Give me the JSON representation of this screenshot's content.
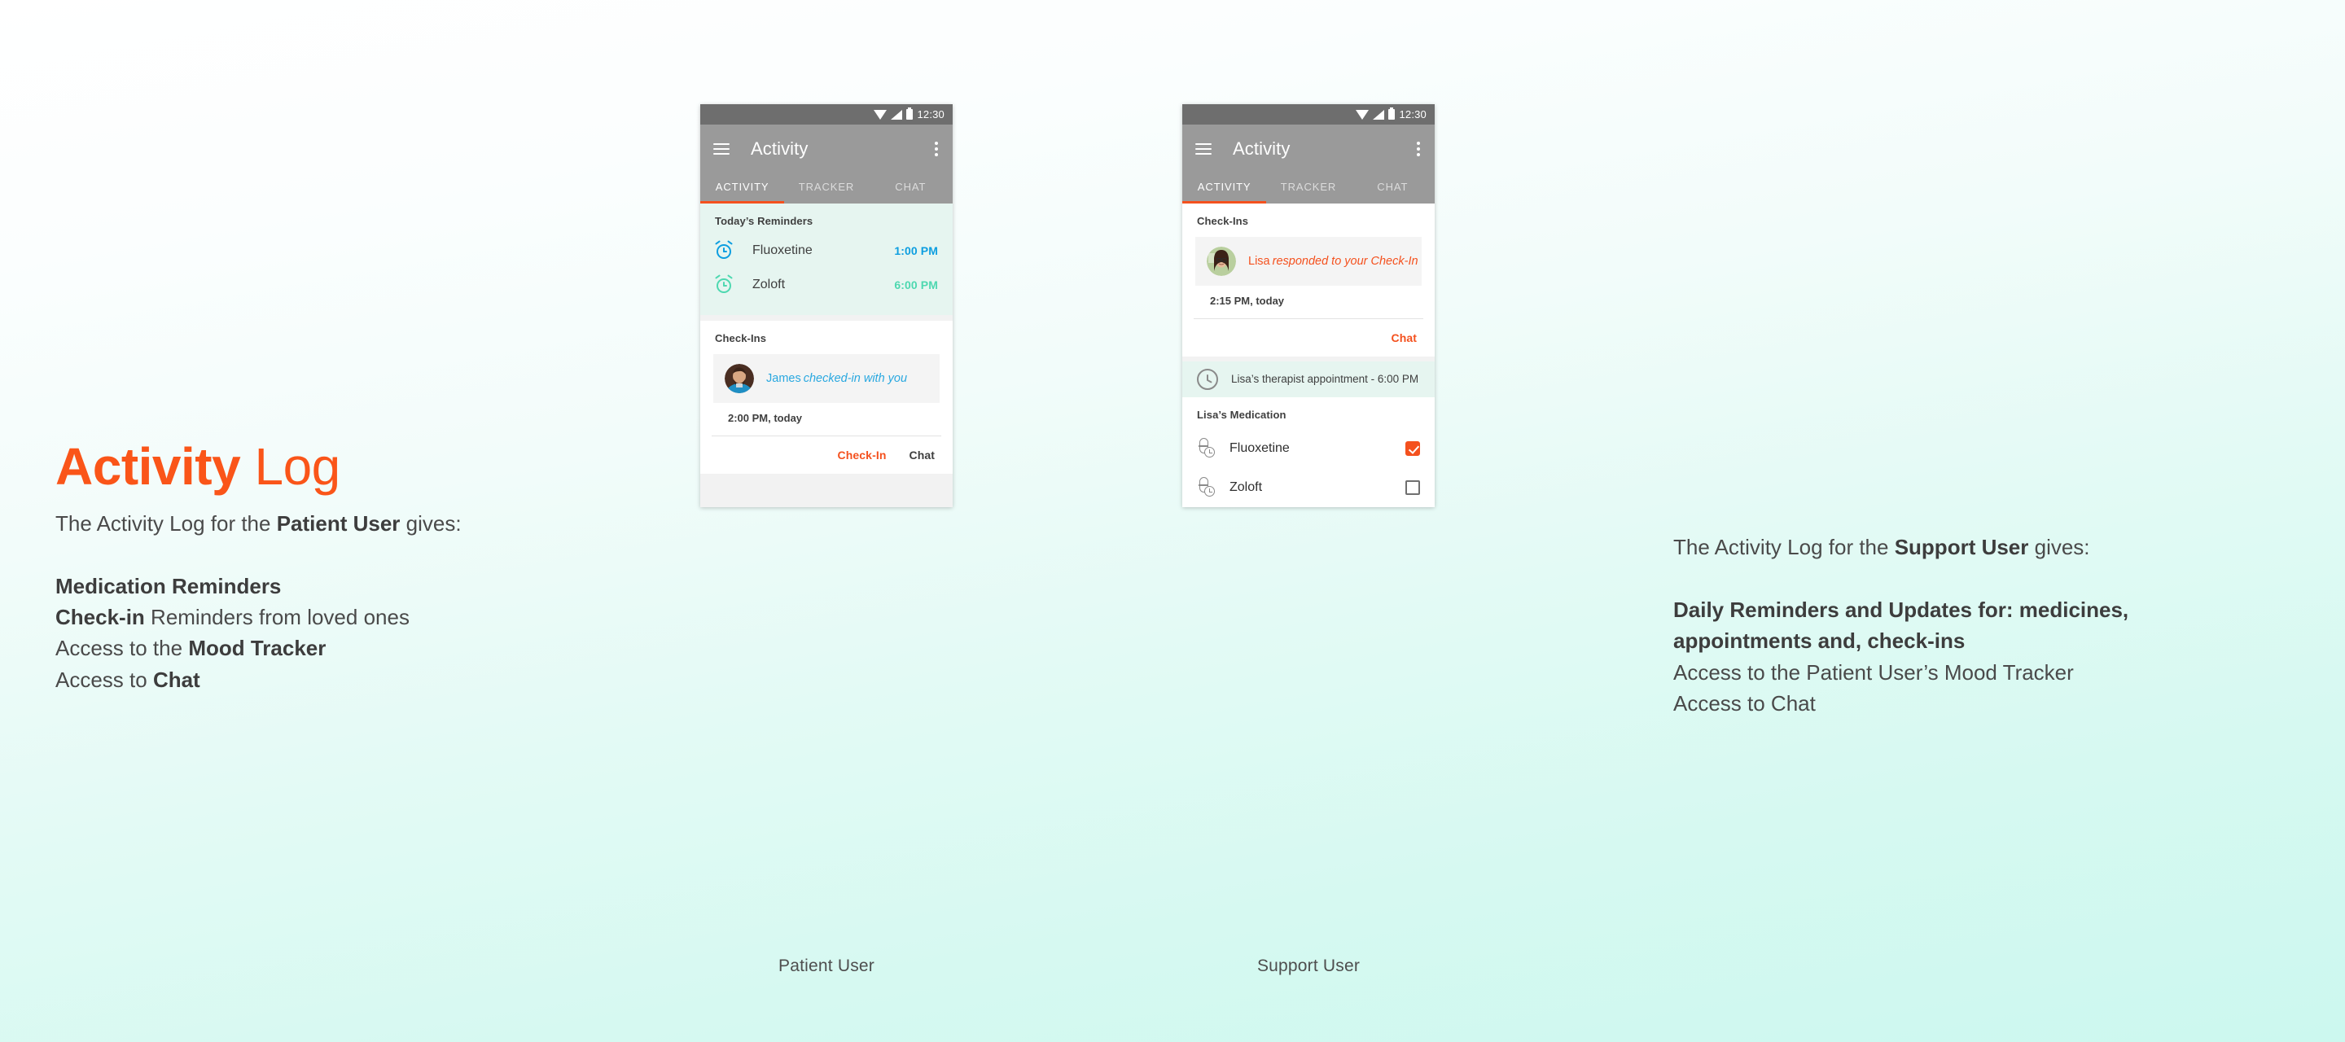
{
  "colors": {
    "accent_orange": "#fa5519",
    "material_orange": "#f4511e",
    "link_blue": "#29a8e0",
    "reminder_blue": "#0d9ee0",
    "reminder_teal": "#4ed8b0",
    "mint_section": "#e6f5f0",
    "appbar_gray": "#9a9a9a",
    "statusbar_gray": "#6e6e6e"
  },
  "headline": {
    "accent_word": "Activity",
    "plain_word": "Log"
  },
  "left_copy": {
    "lede_prefix": "The Activity Log for the ",
    "lede_bold": "Patient User",
    "lede_suffix": " gives:",
    "bullets": [
      {
        "bold": "Medication Reminders",
        "plain": ""
      },
      {
        "bold": "Check-in",
        "plain": " Reminders from loved ones"
      },
      {
        "bold": "",
        "plain": "Access to the ",
        "bold_tail": "Mood Tracker"
      },
      {
        "bold": "",
        "plain": "Access to ",
        "bold_tail": "Chat"
      }
    ]
  },
  "right_copy": {
    "lede_prefix": "The Activity Log for the ",
    "lede_bold": "Support User",
    "lede_suffix": " gives:",
    "bullets": [
      {
        "all_bold": "Daily Reminders and Updates for: medicines,"
      },
      {
        "all_bold": "appointments and, check-ins"
      },
      {
        "plain": "Access to the Patient User’s Mood Tracker"
      },
      {
        "plain": "Access to Chat"
      }
    ]
  },
  "status_bar": {
    "time": "12:30",
    "icons": [
      "wifi-icon",
      "signal-icon",
      "battery-icon"
    ]
  },
  "app_bar": {
    "title": "Activity",
    "menu_icon": "hamburger-icon",
    "overflow_icon": "overflow-menu-icon",
    "tabs": [
      {
        "label": "ACTIVITY",
        "active": true
      },
      {
        "label": "TRACKER",
        "active": false
      },
      {
        "label": "CHAT",
        "active": false
      }
    ]
  },
  "patient_phone": {
    "caption": "Patient User",
    "reminders": {
      "section_label": "Today’s Reminders",
      "items": [
        {
          "icon": "alarm-clock-icon",
          "name": "Fluoxetine",
          "time": "1:00 PM",
          "color": "#0d9ee0"
        },
        {
          "icon": "alarm-clock-icon",
          "name": "Zoloft",
          "time": "6:00 PM",
          "color": "#4ed8b0"
        }
      ]
    },
    "checkins": {
      "section_label": "Check-Ins",
      "person": "James",
      "message": "checked-in with you",
      "message_color": "#29a8e0",
      "timestamp": "2:00 PM, today",
      "actions": [
        {
          "label": "Check-In",
          "style": "orange"
        },
        {
          "label": "Chat",
          "style": "dark"
        }
      ]
    }
  },
  "support_phone": {
    "caption": "Support User",
    "checkins": {
      "section_label": "Check-Ins",
      "person": "Lisa",
      "message": "responded to your Check-In",
      "message_color": "#f4511e",
      "timestamp": "2:15 PM, today",
      "actions": [
        {
          "label": "Chat",
          "style": "orange"
        }
      ]
    },
    "appointment": {
      "icon": "clock-icon",
      "text": "Lisa’s therapist appointment - 6:00 PM"
    },
    "medication": {
      "section_label": "Lisa’s Medication",
      "items": [
        {
          "icon": "pill-clock-icon",
          "name": "Fluoxetine",
          "checked": true
        },
        {
          "icon": "pill-clock-icon",
          "name": "Zoloft",
          "checked": false
        }
      ]
    }
  },
  "nav_bar": {
    "back_icon": "back-triangle-icon",
    "home_icon": "home-circle-icon",
    "recents_icon": "recents-square-icon"
  }
}
